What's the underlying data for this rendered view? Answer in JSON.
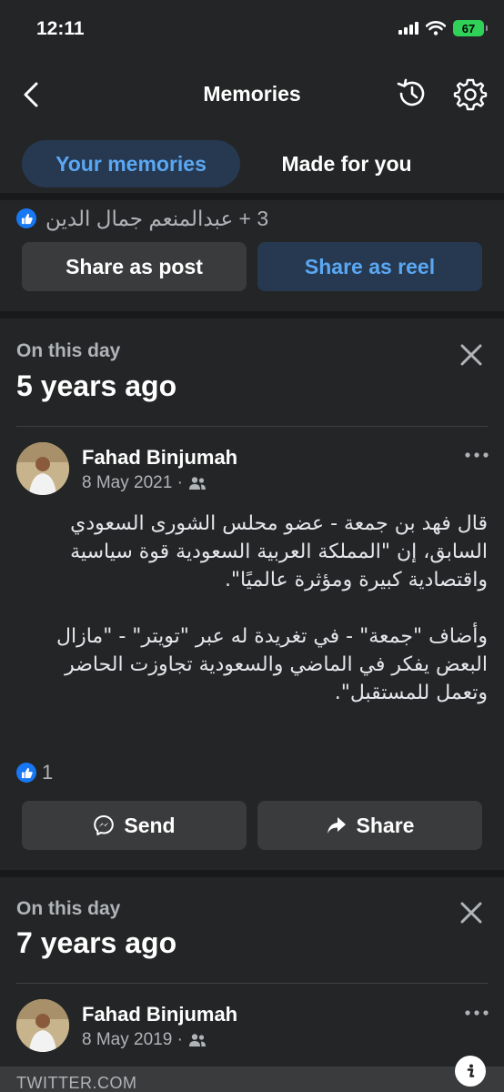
{
  "status_bar": {
    "time": "12:11",
    "battery": "67"
  },
  "nav": {
    "title": "Memories"
  },
  "tabs": {
    "active": "Your memories",
    "inactive": "Made for you"
  },
  "reactors": {
    "text": "3 + عبدالمنعم جمال الدين"
  },
  "share_buttons": {
    "post": "Share as post",
    "reel": "Share as reel"
  },
  "memories": [
    {
      "kicker": "On this day",
      "heading": "5 years ago",
      "author": "Fahad Binjumah",
      "date": "8 May 2021 ·",
      "body": "قال فهد بن جمعة - عضو محلس الشورى السعودي السابق، إن \"المملكة العربية السعودية قوة سياسية واقتصادية كبيرة ومؤثرة عالميًا\".\n\nوأضاف \"جمعة\" - في تغريدة له عبر \"تويتر\" - \"مازال البعض يفكر في الماضي والسعودية تجاوزت الحاضر وتعمل للمستقبل\".",
      "likes": "1",
      "send_label": "Send",
      "share_label": "Share"
    },
    {
      "kicker": "On this day",
      "heading": "7 years ago",
      "author": "Fahad Binjumah",
      "date": "8 May 2019 ·",
      "link_domain": "TWITTER.COM"
    }
  ],
  "colors": {
    "background": "#242526",
    "separator": "#18191a",
    "accent": "#5aa7f3",
    "accent_bg": "#263951",
    "button": "#3a3b3c",
    "like": "#1877f2"
  }
}
